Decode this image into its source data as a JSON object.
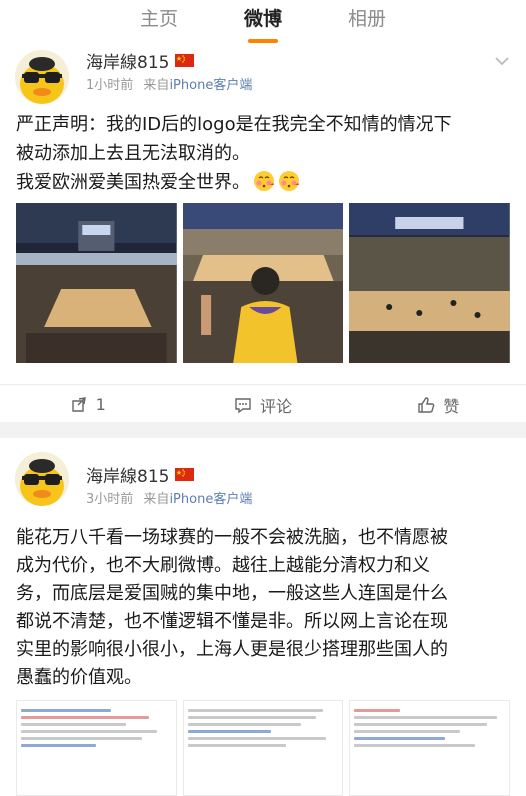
{
  "tabs": [
    {
      "label": "主页"
    },
    {
      "label": "微博",
      "active": true
    },
    {
      "label": "相册"
    }
  ],
  "posts": [
    {
      "username": "海岸線815",
      "time": "1小时前",
      "source_prefix": "来自",
      "source": "iPhone客户端",
      "lines": [
        "严正声明：我的ID后的logo是在我完全不知情的情况下",
        "被动添加上去且无法取消的。",
        "我爱欧洲爱美国热爱全世界。"
      ],
      "actions": {
        "repost": "1",
        "comment": "评论",
        "like": "赞"
      }
    },
    {
      "username": "海岸線815",
      "time": "3小时前",
      "source_prefix": "来自",
      "source": "iPhone客户端",
      "lines": [
        "能花万八千看一场球赛的一般不会被洗脑，也不情愿被",
        "成为代价，也不大刷微博。越往上越能分清权力和义",
        "务，而底层是爱国贼的集中地，一般这些人连国是什么",
        "都说不清楚，也不懂逻辑不懂是非。所以网上言论在现",
        "实里的影响很小很小，上海人更是很少搭理那些国人的",
        "愚蠢的价值观。"
      ]
    }
  ],
  "icons": {
    "flag": "china-flag-icon",
    "emoji": "kissing-face-icon",
    "repost": "repost-icon",
    "comment": "comment-icon",
    "like": "thumbs-up-icon",
    "more": "chevron-down-icon"
  },
  "colors": {
    "accent": "#ff8200",
    "link": "#5b7fb0",
    "flag_red": "#de2910",
    "flag_star": "#ffde00"
  }
}
